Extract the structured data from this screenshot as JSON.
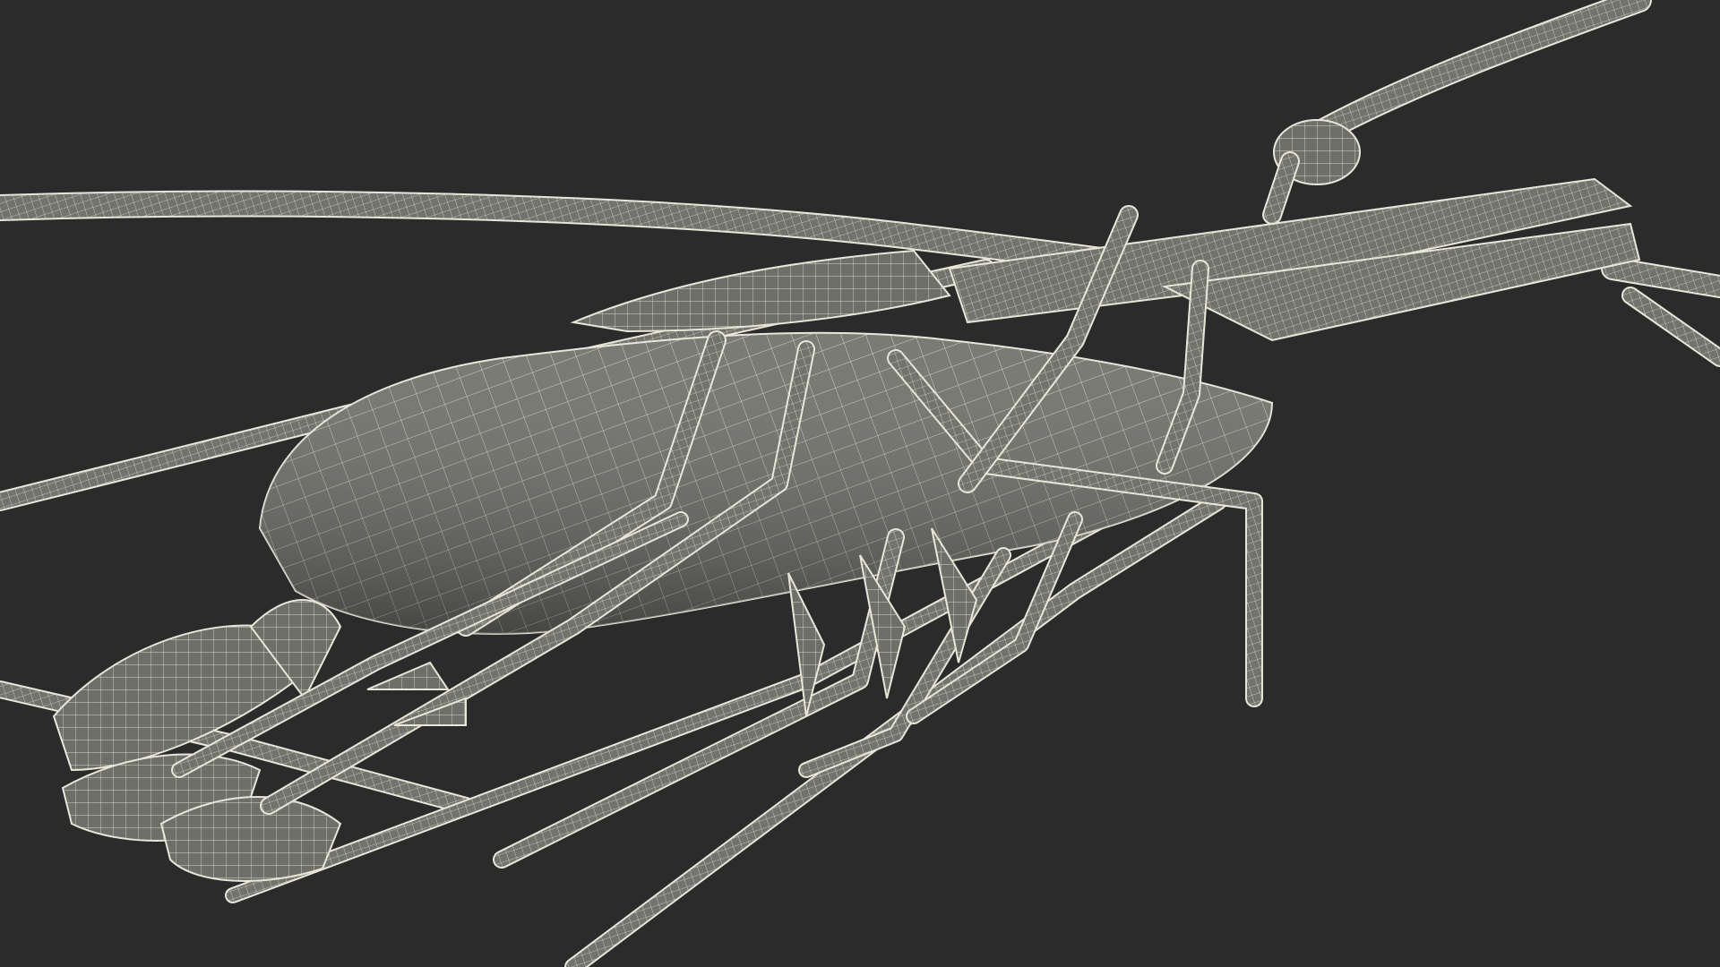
{
  "scene": {
    "subject": "",
    "background_color": "#2b2b2b",
    "mesh_fill_color": "#6e6f68",
    "mesh_fill_dark": "#4f504b",
    "mesh_fill_light": "#8a8b83",
    "wire_color": "#e8e6d8",
    "shadow_color": "#1f1f1f"
  }
}
